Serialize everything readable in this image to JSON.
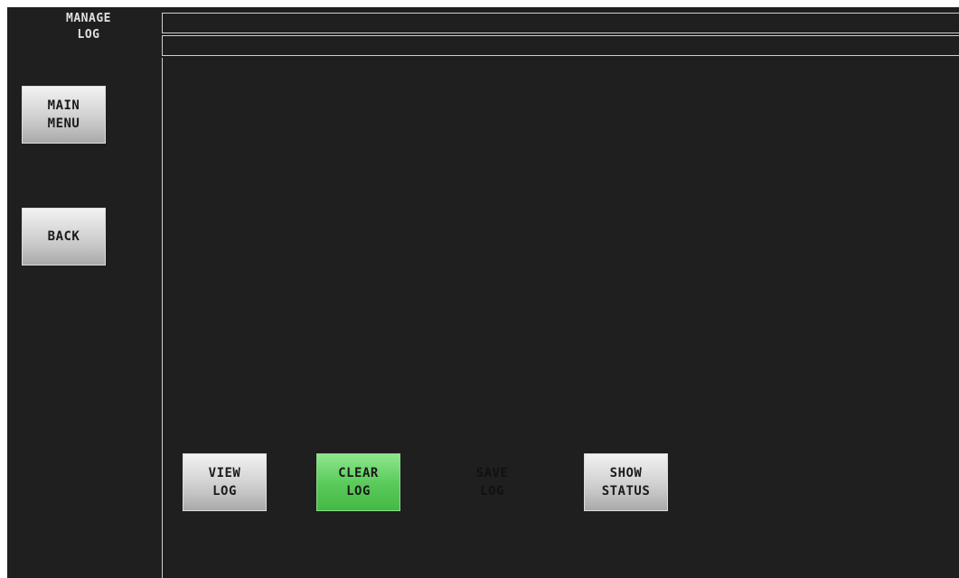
{
  "screen": {
    "title_line1": "MANAGE",
    "title_line2": "LOG"
  },
  "sidebar": {
    "main_menu": {
      "line1": "MAIN",
      "line2": "MENU"
    },
    "back": {
      "label": "BACK"
    }
  },
  "actions": {
    "view_log": {
      "line1": "VIEW",
      "line2": "LOG"
    },
    "clear_log": {
      "line1": "CLEAR",
      "line2": "LOG",
      "state": "selected"
    },
    "save_log": {
      "line1": "SAVE",
      "line2": "LOG",
      "state": "disabled"
    },
    "show_status": {
      "line1": "SHOW",
      "line2": "STATUS"
    }
  },
  "status_fields": {
    "line1": "",
    "line2": ""
  },
  "colors": {
    "background": "#1f1f1f",
    "button": "#c8c8c8",
    "button_selected": "#5ccc5c",
    "border": "#cfcfcf"
  }
}
